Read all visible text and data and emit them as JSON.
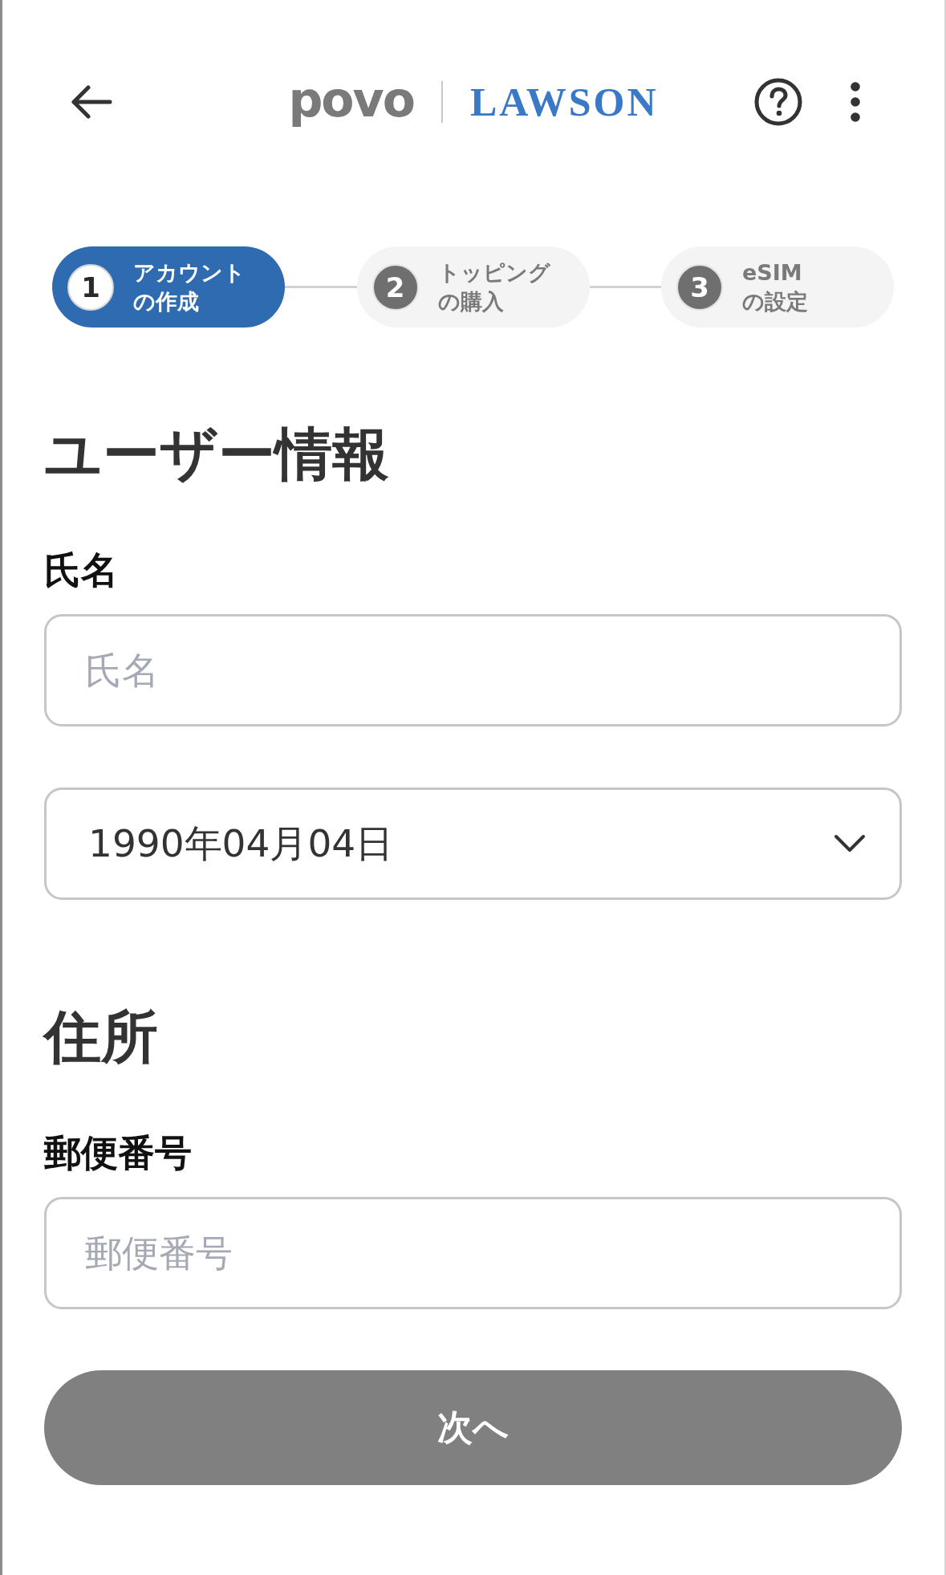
{
  "header": {
    "logo": "povo",
    "partner_logo": "LAWSON"
  },
  "steps": [
    {
      "number": "1",
      "label_lines": [
        "アカウント",
        "の作成"
      ],
      "selected": true
    },
    {
      "number": "2",
      "label_lines": [
        "トッピング",
        "の購入"
      ],
      "selected": false
    },
    {
      "number": "3",
      "label_lines": [
        "eSIM",
        "の設定"
      ],
      "selected": false
    }
  ],
  "sections": [
    {
      "title": "ユーザー情報",
      "fields": [
        {
          "kind": "text",
          "label": "氏名",
          "placeholder": "氏名"
        },
        {
          "kind": "select",
          "value": "1990年04月04日"
        }
      ]
    },
    {
      "title": "住所",
      "fields": [
        {
          "kind": "text",
          "label": "郵便番号",
          "placeholder": "郵便番号"
        }
      ]
    }
  ],
  "next_button": {
    "label": "次へ",
    "disabled": true
  }
}
